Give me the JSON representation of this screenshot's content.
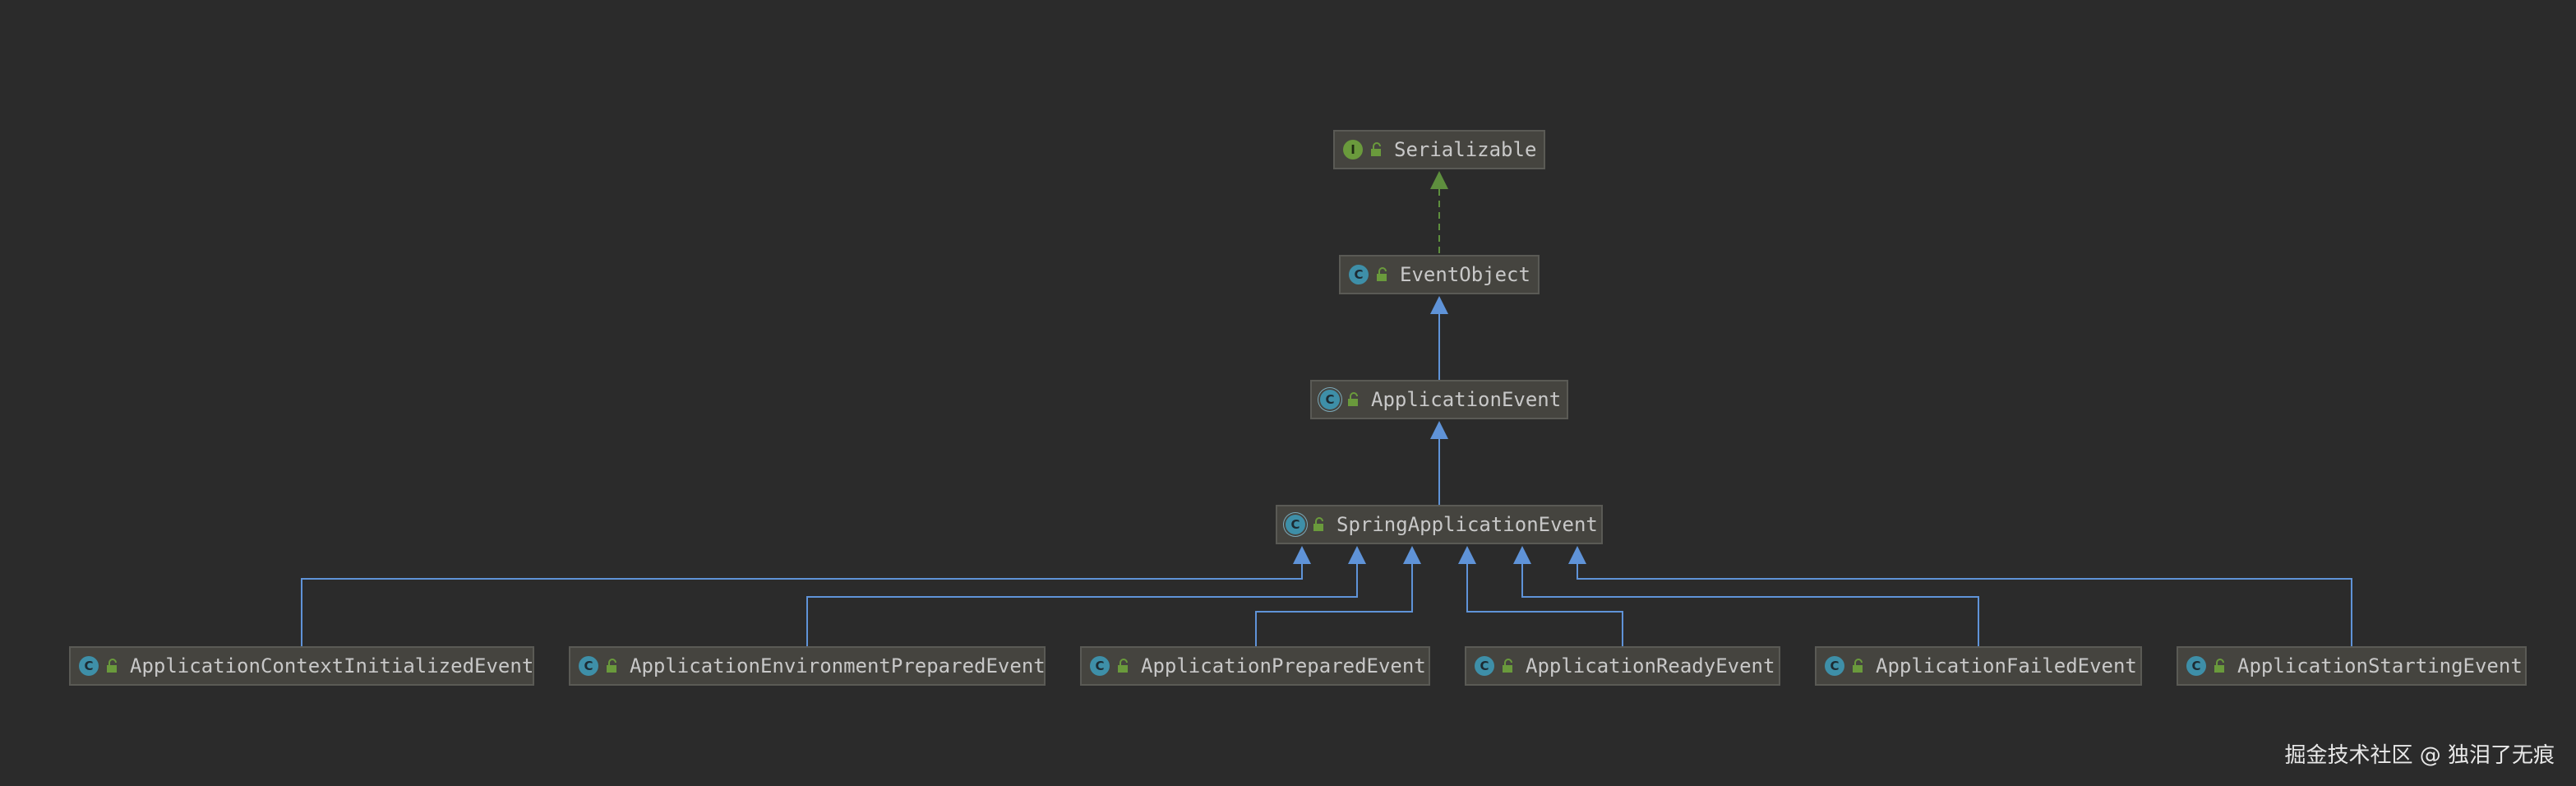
{
  "nodes": {
    "serializable": {
      "label": "Serializable",
      "kind": "interface",
      "kind_letter": "I",
      "icon": "interface-icon"
    },
    "event_object": {
      "label": "EventObject",
      "kind": "class",
      "kind_letter": "C",
      "icon": "class-icon"
    },
    "application_event": {
      "label": "ApplicationEvent",
      "kind": "abstract",
      "kind_letter": "C",
      "icon": "abstract-class-icon"
    },
    "spring_app_event": {
      "label": "SpringApplicationEvent",
      "kind": "abstract",
      "kind_letter": "C",
      "icon": "abstract-class-icon"
    },
    "ctx_initialized": {
      "label": "ApplicationContextInitializedEvent",
      "kind": "class",
      "kind_letter": "C",
      "icon": "class-icon"
    },
    "env_prepared": {
      "label": "ApplicationEnvironmentPreparedEvent",
      "kind": "class",
      "kind_letter": "C",
      "icon": "class-icon"
    },
    "app_prepared": {
      "label": "ApplicationPreparedEvent",
      "kind": "class",
      "kind_letter": "C",
      "icon": "class-icon"
    },
    "app_ready": {
      "label": "ApplicationReadyEvent",
      "kind": "class",
      "kind_letter": "C",
      "icon": "class-icon"
    },
    "app_failed": {
      "label": "ApplicationFailedEvent",
      "kind": "class",
      "kind_letter": "C",
      "icon": "class-icon"
    },
    "app_starting": {
      "label": "ApplicationStartingEvent",
      "kind": "class",
      "kind_letter": "C",
      "icon": "class-icon"
    }
  },
  "relations": [
    {
      "from": "event_object",
      "to": "serializable",
      "type": "implements"
    },
    {
      "from": "application_event",
      "to": "event_object",
      "type": "extends"
    },
    {
      "from": "spring_app_event",
      "to": "application_event",
      "type": "extends"
    },
    {
      "from": "ctx_initialized",
      "to": "spring_app_event",
      "type": "extends"
    },
    {
      "from": "env_prepared",
      "to": "spring_app_event",
      "type": "extends"
    },
    {
      "from": "app_prepared",
      "to": "spring_app_event",
      "type": "extends"
    },
    {
      "from": "app_ready",
      "to": "spring_app_event",
      "type": "extends"
    },
    {
      "from": "app_failed",
      "to": "spring_app_event",
      "type": "extends"
    },
    {
      "from": "app_starting",
      "to": "spring_app_event",
      "type": "extends"
    }
  ],
  "colors": {
    "background": "#2b2b2b",
    "extends_line": "#5f93d8",
    "implements_line": "#5e8f3e",
    "lock_icon": "#6a9a3c"
  },
  "watermark": "掘金技术社区 @ 独泪了无痕"
}
